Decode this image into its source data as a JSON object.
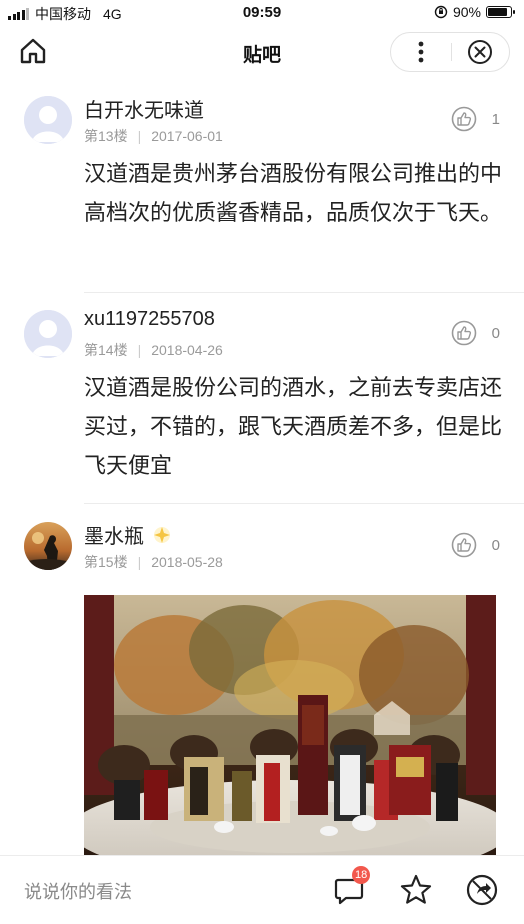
{
  "status_bar": {
    "carrier": "中国移动",
    "network": "4G",
    "time": "09:59",
    "battery_text": "90%",
    "battery_level": 0.9
  },
  "nav": {
    "title": "贴吧",
    "icons": {
      "home": "home-icon",
      "more": "more-vertical-icon",
      "close": "close-circle-icon"
    }
  },
  "posts": [
    {
      "username": "白开水无味道",
      "floor": "第13楼",
      "date": "2017-06-01",
      "likes": "1",
      "content": "汉道酒是贵州茅台酒股份有限公司推出的中高档次的优质酱香精品，品质仅次于飞天。"
    },
    {
      "username": "xu1197255708",
      "floor": "第14楼",
      "date": "2018-04-26",
      "likes": "0",
      "content": "汉道酒是股份公司的酒水，之前去专卖店还买过，不错的，跟飞天酒质差不多，但是比飞天便宜"
    },
    {
      "username": "墨水瓶",
      "floor": "第15楼",
      "date": "2018-05-28",
      "likes": "0",
      "content": ""
    }
  ],
  "bottom_bar": {
    "placeholder": "说说你的看法",
    "comment_count": "18",
    "icons": {
      "comments": "comment-icon",
      "favorite": "star-icon",
      "share": "share-icon"
    }
  },
  "colors": {
    "badge": "#f2584d",
    "meta_text": "#9a9a9a",
    "avatar_default": "#dfe3f4"
  }
}
